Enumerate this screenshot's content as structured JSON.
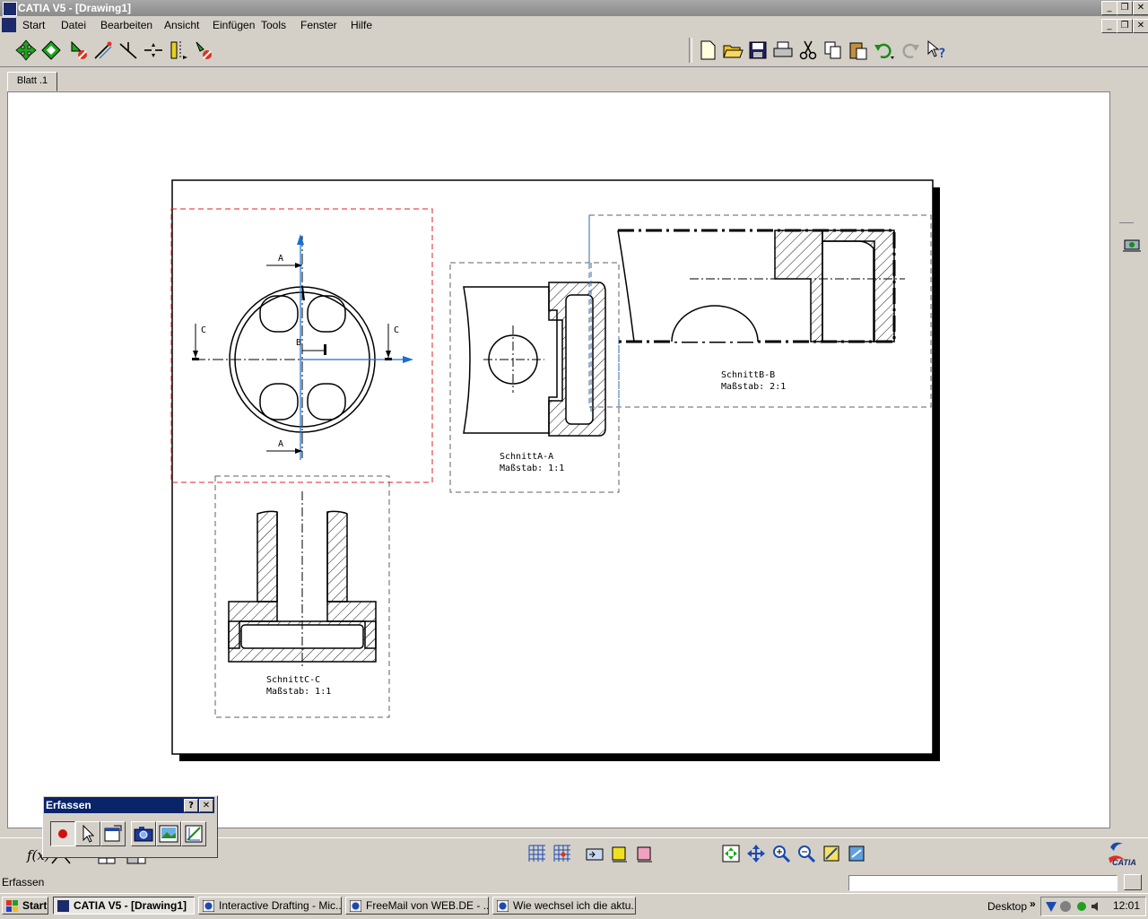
{
  "window": {
    "title": "CATIA V5 - [Drawing1]"
  },
  "menu": [
    "Start",
    "Datei",
    "Bearbeiten",
    "Ansicht",
    "Einfügen",
    "Tools",
    "Fenster",
    "Hilfe"
  ],
  "sheet_tab": "Blatt .1",
  "views": {
    "section_a": {
      "name": "SchnittA-A",
      "scale": "Maßstab:  1:1"
    },
    "section_b": {
      "name": "SchnittB-B",
      "scale": "Maßstab:  2:1"
    },
    "section_c": {
      "name": "SchnittC-C",
      "scale": "Maßstab:  1:1"
    },
    "labels": {
      "a_top": "A",
      "a_bottom": "A",
      "b": "B",
      "c_left": "C",
      "c_right": "C"
    }
  },
  "palette": {
    "title": "Erfassen",
    "help": "?",
    "close": "✕"
  },
  "status": {
    "text": "Erfassen"
  },
  "taskbar": {
    "start": "Start",
    "tasks": [
      "CATIA V5 - [Drawing1]",
      "Interactive Drafting - Mic...",
      "FreeMail von WEB.DE - ...",
      "Wie wechsel ich die aktu..."
    ],
    "desktop": "Desktop",
    "clock": "12:01"
  },
  "brand": "CATIA",
  "colors": {
    "accent_blue": "#0a246a",
    "view_frame_red": "#e02020",
    "view_frame_blue": "#1a6fd0"
  }
}
